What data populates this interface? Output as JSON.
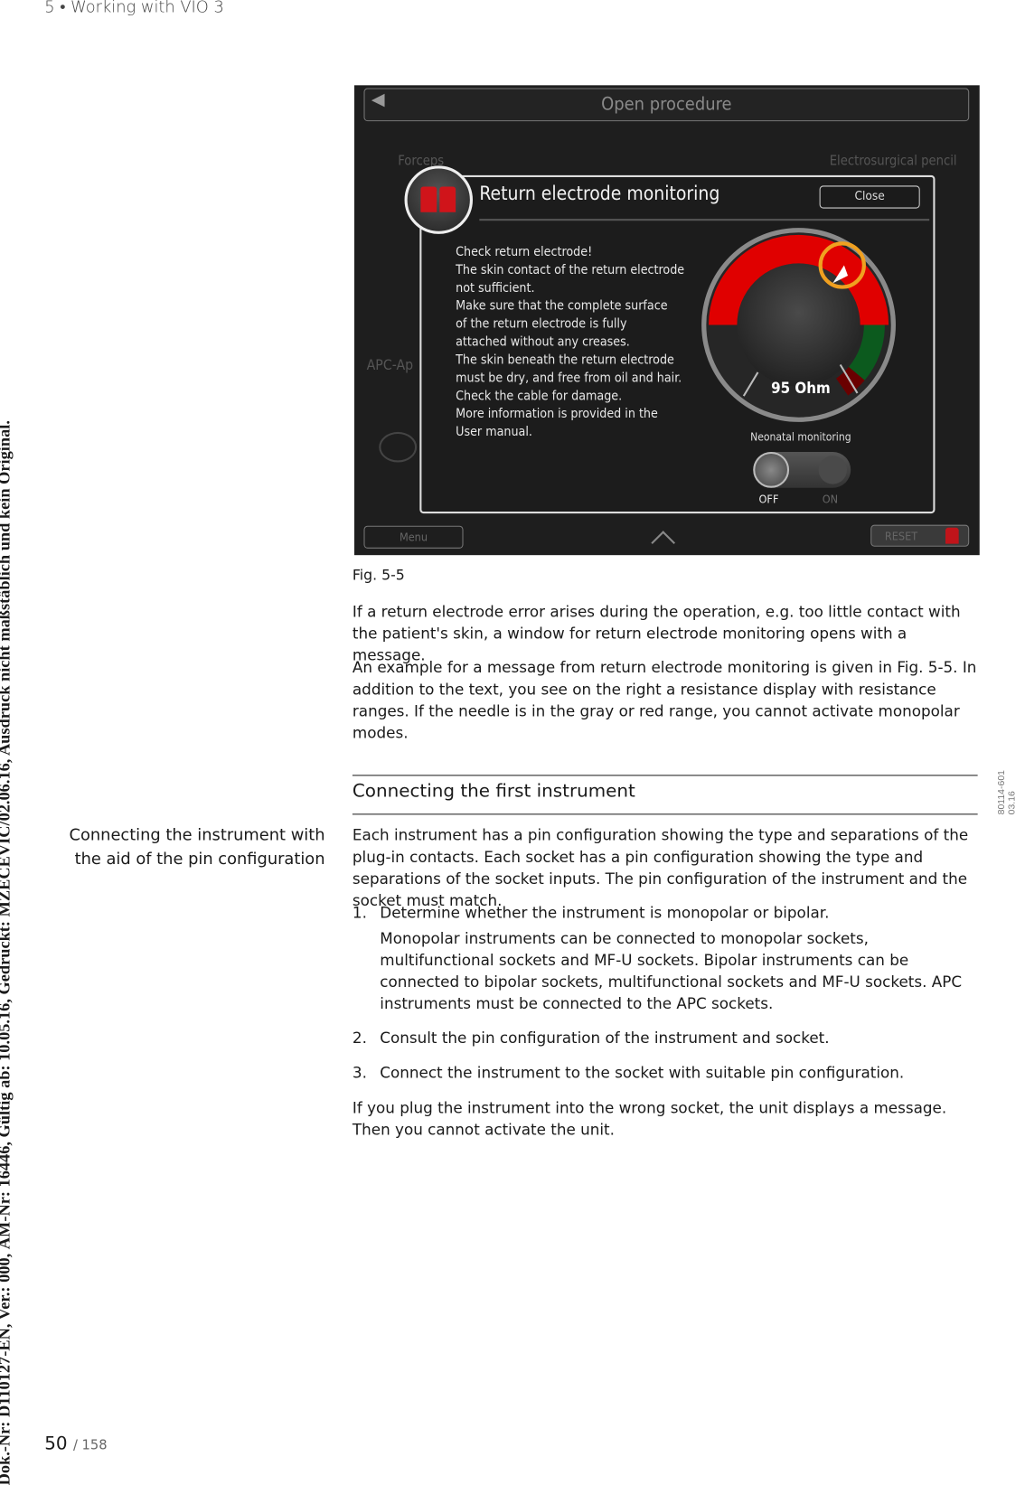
{
  "running_header": "5  •  Working with VIO 3",
  "side_note": "Dok.-Nr: D110127-EN, Ver.: 000, ÄM-Nr: 16446, Gültig ab: 10.05.16, Gedruckt: MZECEVIC/02.06.16, Ausdruck nicht maßstäblich und kein Original.",
  "doc_id": {
    "line1": "80114-601",
    "line2": "03.16"
  },
  "screenshot": {
    "top_title": "Open procedure",
    "left_socket": "Forceps",
    "right_socket": "Electrosurgical pencil",
    "apc_label": "APC-Ap",
    "dialog_title": "Return electrode monitoring",
    "close_label": "Close",
    "message_lines": [
      "Check return electrode!",
      "The skin contact of the return electrode",
      "not sufficient.",
      "Make sure that the complete surface",
      "of the return electrode is fully",
      "attached without any creases.",
      "The skin beneath the return electrode",
      "must be dry, and free from oil and hair.",
      "Check the cable for damage.",
      "More information is provided in the",
      "User manual."
    ],
    "resistance": "95 Ohm",
    "neonatal_label": "Neonatal monitoring",
    "toggle_off": "OFF",
    "toggle_on": "ON",
    "toggle_state": "off",
    "menu_label": "Menu",
    "reset_label": "RESET",
    "colors": {
      "red_range": "#e00000",
      "green_range": "#0c5a1e",
      "dark_red_range": "#6a0000",
      "highlight": "#f0a020"
    }
  },
  "fig_caption": "Fig. 5-5",
  "paragraphs": [
    "If a return electrode error arises during the operation, e.g. too little contact with the patient's skin, a window for return electrode monitoring opens with a message.",
    "An example for a message from return electrode monitoring is given in Fig. 5-5. In addition to the text, you see on the right a resistance display with resistance ranges. If the needle is in the gray or red range, you cannot activate monopolar modes."
  ],
  "section": {
    "heading": "Connecting the first instrument",
    "side_heading": "Connecting the instrument with the aid of the pin configuration",
    "intro": "Each instrument has a pin configuration showing the type and separations of the plug-in contacts. Each socket has a pin configuration showing the type and separations of the socket inputs. The pin configuration of the instrument and the socket must match.",
    "steps": [
      {
        "num": "1.",
        "text": "Determine whether the instrument is monopolar or bipolar.",
        "detail": "Monopolar instruments can be connected to monopolar sockets, multifunctional sockets and MF-U sockets. Bipolar instruments can be connected to bipolar sockets, multifunctional sockets and MF-U sockets. APC instruments must be connected to the APC sockets."
      },
      {
        "num": "2.",
        "text": "Consult the pin configuration of the instrument and socket."
      },
      {
        "num": "3.",
        "text": "Connect the instrument to the socket with suitable pin configuration."
      }
    ],
    "outro": "If you plug the instrument into the wrong socket, the unit displays a message. Then you cannot activate the unit."
  },
  "page": {
    "current": "50",
    "total": "/ 158"
  }
}
